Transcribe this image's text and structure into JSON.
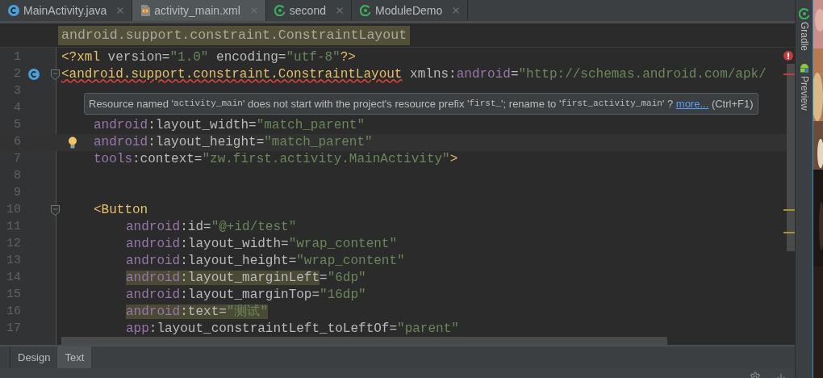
{
  "editor_tabs": [
    {
      "label": "MainActivity.java",
      "kind": "java",
      "selected": false
    },
    {
      "label": "activity_main.xml",
      "kind": "xml",
      "selected": true
    },
    {
      "label": "second",
      "kind": "module",
      "selected": false
    },
    {
      "label": "ModuleDemo",
      "kind": "module",
      "selected": false
    }
  ],
  "breadcrumb": "android.support.constraint.ConstraintLayout",
  "lines": [
    {
      "number": "1",
      "current": false,
      "fold": false,
      "tokens": [
        {
          "text": "<?xml",
          "kind": "tag",
          "error": false
        },
        {
          "text": " version=",
          "kind": "attr"
        },
        {
          "text": "\"1.0\"",
          "kind": "value"
        },
        {
          "text": " encoding=",
          "kind": "attr"
        },
        {
          "text": "\"utf-8\"",
          "kind": "value"
        },
        {
          "text": "?>",
          "kind": "tag"
        }
      ]
    },
    {
      "number": "2",
      "current": false,
      "fold": true,
      "kind": "class-marker",
      "tokens": [
        {
          "text": "<android.support.constraint.ConstraintLayout",
          "kind": "tag",
          "error": true
        },
        {
          "text": " xmlns:",
          "kind": "attr"
        },
        {
          "text": "android",
          "kind": "ns"
        },
        {
          "text": "=",
          "kind": "attr"
        },
        {
          "text": "\"http://schemas.android.com/apk/",
          "kind": "value"
        }
      ],
      "children": [
        {
          "number": "3",
          "current": false,
          "fold": false
        },
        {
          "number": "4",
          "current": false,
          "fold": false
        },
        {
          "number": "5",
          "current": false,
          "fold": false,
          "tokens": [
            {
              "text": "android",
              "kind": "ns"
            },
            {
              "text": ":layout_width=",
              "kind": "attr"
            },
            {
              "text": "\"match_parent\"",
              "kind": "value"
            }
          ]
        },
        {
          "number": "6",
          "current": true,
          "fold": false,
          "kind": "bulb",
          "tokens": [
            {
              "text": "android",
              "kind": "ns"
            },
            {
              "text": ":layout_height=",
              "kind": "attr"
            },
            {
              "text": "\"match_parent\"",
              "kind": "value"
            }
          ]
        },
        {
          "number": "7",
          "current": false,
          "fold": false,
          "tokens": [
            {
              "text": "tools",
              "kind": "ns"
            },
            {
              "text": ":context=",
              "kind": "attr"
            },
            {
              "text": "\"zw.first.activity.MainActivity\"",
              "kind": "value"
            },
            {
              "text": ">",
              "kind": "tag"
            }
          ]
        },
        {
          "number": "8",
          "current": false,
          "fold": false
        },
        {
          "number": "9",
          "current": false,
          "fold": false
        },
        {
          "number": "10",
          "current": false,
          "fold": true,
          "tokens": [
            {
              "text": "<Button",
              "kind": "tag"
            }
          ],
          "children": [
            {
              "number": "11",
              "current": false,
              "fold": false,
              "tokens": [
                {
                  "text": "android",
                  "kind": "ns"
                },
                {
                  "text": ":id=",
                  "kind": "attr"
                },
                {
                  "text": "\"@+id/test\"",
                  "kind": "value"
                }
              ]
            },
            {
              "number": "12",
              "current": false,
              "fold": false,
              "tokens": [
                {
                  "text": "android",
                  "kind": "ns"
                },
                {
                  "text": ":layout_width=",
                  "kind": "attr"
                },
                {
                  "text": "\"wrap_content\"",
                  "kind": "value"
                }
              ]
            },
            {
              "number": "13",
              "current": false,
              "fold": false,
              "tokens": [
                {
                  "text": "android",
                  "kind": "ns"
                },
                {
                  "text": ":layout_height=",
                  "kind": "attr"
                },
                {
                  "text": "\"wrap_content\"",
                  "kind": "value"
                }
              ]
            },
            {
              "number": "14",
              "current": false,
              "fold": false,
              "tokens": [
                {
                  "text": "android",
                  "kind": "ns",
                  "highlighted": true
                },
                {
                  "text": ":layout_marginLeft",
                  "kind": "attr",
                  "highlighted": true
                },
                {
                  "text": "=",
                  "kind": "attr",
                  "highlighted": false
                },
                {
                  "text": "\"6dp\"",
                  "kind": "value",
                  "highlighted": false
                }
              ]
            },
            {
              "number": "15",
              "current": false,
              "fold": false,
              "tokens": [
                {
                  "text": "android",
                  "kind": "ns"
                },
                {
                  "text": ":layout_marginTop=",
                  "kind": "attr"
                },
                {
                  "text": "\"16dp\"",
                  "kind": "value"
                }
              ]
            },
            {
              "number": "16",
              "current": false,
              "fold": false,
              "tokens": [
                {
                  "text": "android",
                  "kind": "ns",
                  "highlighted": true
                },
                {
                  "text": ":text=",
                  "kind": "attr",
                  "highlighted": true
                },
                {
                  "text": "\"测试\"",
                  "kind": "value",
                  "highlighted": true
                }
              ]
            },
            {
              "number": "17",
              "current": false,
              "fold": false,
              "tokens": [
                {
                  "text": "app",
                  "kind": "ns"
                },
                {
                  "text": ":layout_constraintLeft_toLeftOf=",
                  "kind": "attr"
                },
                {
                  "text": "\"parent\"",
                  "kind": "value"
                }
              ]
            }
          ]
        }
      ]
    }
  ],
  "tooltip": [
    {
      "text": "Resource named '",
      "kind": "text"
    },
    {
      "text": "activity_main",
      "kind": "code"
    },
    {
      "text": "' does not start with the project's resource prefix '",
      "kind": "text"
    },
    {
      "text": "first_",
      "kind": "code"
    },
    {
      "text": "'; rename to '",
      "kind": "text"
    },
    {
      "text": "first_activity_main",
      "kind": "code"
    },
    {
      "text": "' ? ",
      "kind": "text"
    },
    {
      "text": "more...",
      "kind": "link"
    },
    {
      "text": " (Ctrl+F1)",
      "kind": "text"
    }
  ],
  "bottom_tabs": [
    {
      "label": "Design",
      "selected": false
    },
    {
      "label": "Text",
      "selected": true
    }
  ],
  "side_tools": [
    {
      "label": "Gradle",
      "kind": "gradle"
    },
    {
      "label": "Preview",
      "kind": "android"
    }
  ]
}
